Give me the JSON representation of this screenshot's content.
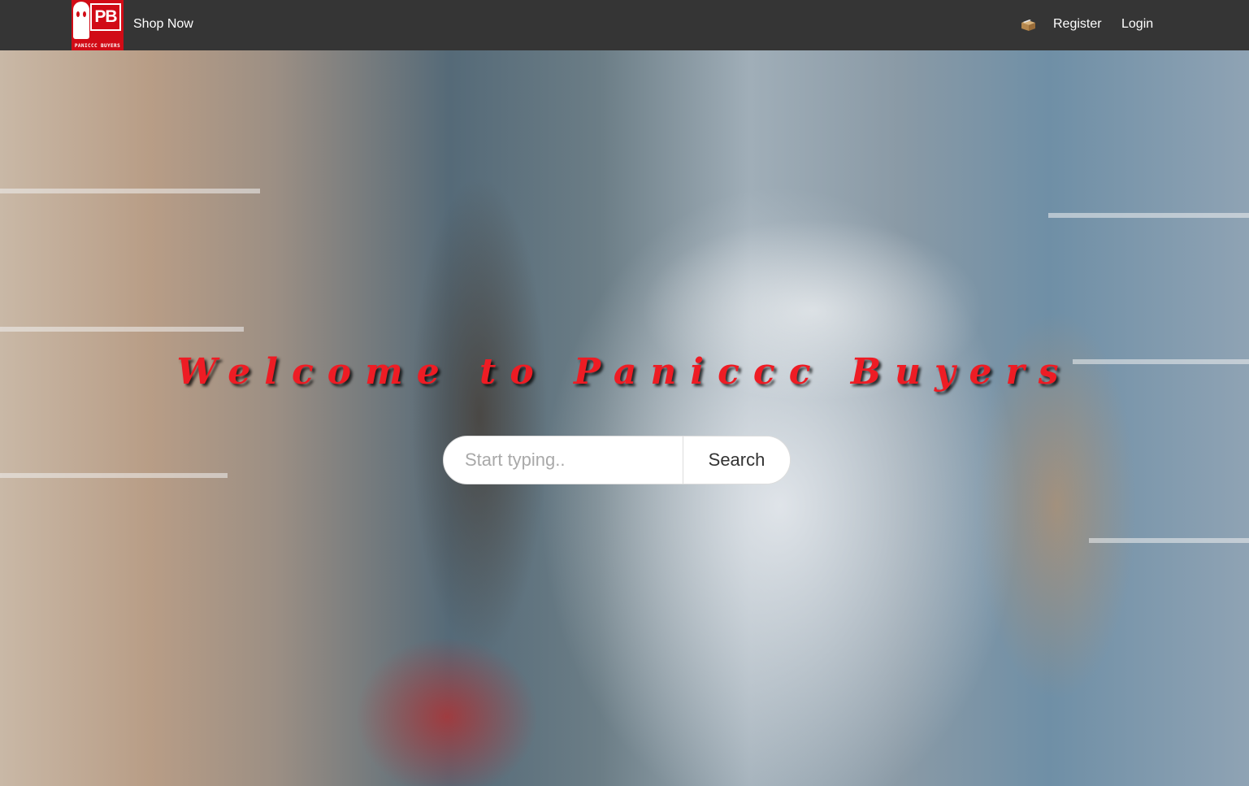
{
  "navbar": {
    "logo": {
      "initials": "PB",
      "subtitle": "PANICCC BUYERS"
    },
    "shop_label": "Shop Now",
    "cart_icon": "cart-icon",
    "register_label": "Register",
    "login_label": "Login"
  },
  "hero": {
    "background_description": "Shoppers in masks in a supermarket aisle, one carrying a large stack of toilet paper",
    "title": "Welcome to Paniccc Buyers",
    "title_color": "#ee1c24",
    "search": {
      "placeholder": "Start typing..",
      "value": "",
      "button_label": "Search"
    }
  },
  "colors": {
    "navbar_background": "#353535",
    "brand_red": "#d10b16",
    "nav_text": "#ffffff"
  }
}
